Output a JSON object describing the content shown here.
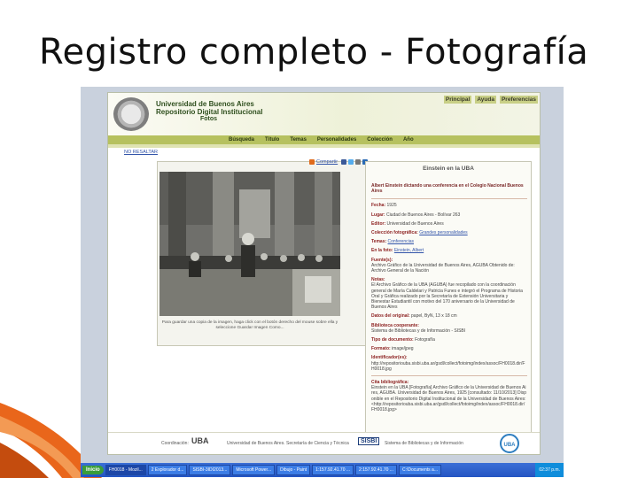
{
  "slide": {
    "title": "Registro completo - Fotografía"
  },
  "site": {
    "header_line1": "Universidad de Buenos Aires",
    "header_line2": "Repositorio Digital Institucional",
    "header_line3": "Fotos",
    "top_links": [
      "Principal",
      "Ayuda",
      "Preferencias"
    ],
    "menu": [
      "Búsqueda",
      "Título",
      "Temas",
      "Personalidades",
      "Colección",
      "Año"
    ],
    "no_resaltar": "NO RESALTAR",
    "share_label": "Compartir",
    "photo_caption": "Para guardar una copia de la imagen, haga click con el botón derecho del mouse sobre ella y seleccione Guardar Imagen Como..."
  },
  "record": {
    "title": "Einstein en la UBA",
    "lead": "Albert Einstein dictando una conferencia en el Colegio Nacional Buenos Aires",
    "fields": [
      {
        "label": "Fecha:",
        "value": "1925"
      },
      {
        "label": "Lugar:",
        "value": "Ciudad de Buenos Aires - Bolívar 263"
      },
      {
        "label": "Editor:",
        "value": "Universidad de Buenos Aires"
      },
      {
        "label": "Colección fotográfica:",
        "value": "Grandes personalidades",
        "link": true
      },
      {
        "label": "Temas:",
        "value": "Conferencias",
        "link": true
      },
      {
        "label": "En la foto:",
        "value": "Einstein, Albert",
        "link": true
      }
    ],
    "fuente_label": "Fuente(s):",
    "fuente_value": "Archivo Gráfico de la Universidad de Buenos Aires, AGUBA Obtenido de: Archivo General de la Nación",
    "notas_label": "Notas:",
    "notas_value": "El Archivo Gráfico de la UBA (AGUBA) fue recopilado con la coordinación general de María Caldelari y Patricia Funes e integró el Programa de Historia Oral y Gráfica realizado por la Secretaría de Extensión Universitaria y Bienestar Estudiantil con motivo del 170 aniversario de la Universidad de Buenos Aires",
    "datos_label": "Datos del original:",
    "datos_value": "papel, ByN, 13 x 18 cm",
    "biblioteca_label": "Biblioteca cooperante:",
    "biblioteca_value": "Sistema de Bibliotecas y de Información - SISBI",
    "tipo_label": "Tipo de documento:",
    "tipo_value": "Fotografía",
    "formato_label": "Formato:",
    "formato_value": "image/jpeg",
    "ident_label": "Identificador(es):",
    "ident_value": "http://repositoriouba.sisbi.uba.ar/gsdl/collect/fotoimg/index/assoc/FH0018.dir/FH0018.jpg",
    "cita_label": "Cita bibliográfica:",
    "cita_value": "Einstein en la UBA [Fotografía] Archivo Gráfico de la Universidad de Buenos Aires, AGUBA. Universidad de Buenos Aires, 1925 [consultado: 11/10/2013] Disponible en el Repositorio Digital Institucional de la Universidad de Buenos Aires: <http://repositoriouba.sisbi.uba.ar/gsdl/collect/fotoimg/index/assoc/FH0018.dir/FH0018.jpg>"
  },
  "footer": {
    "coordinacion": "Coordinación:",
    "uba": "UBA",
    "secretaria": "Universidad de Buenos Aires. Secretaría de Ciencia y Técnica",
    "sisbi": "SISBI",
    "sistema": "Sistema de Bibliotecas y de Información",
    "seal": "UBA"
  },
  "taskbar": {
    "start": "Inicio",
    "tasks": [
      "FH0018 - Mozil...",
      "2 Explorador d...",
      "SISBI-3IDI2013...",
      "Microsoft Power...",
      "Dibujo - Paint",
      "1:157.92.41.70 ...",
      "2:157.92.41.70 ...",
      "C:\\Documents a..."
    ],
    "clock": "02:37 p.m."
  }
}
